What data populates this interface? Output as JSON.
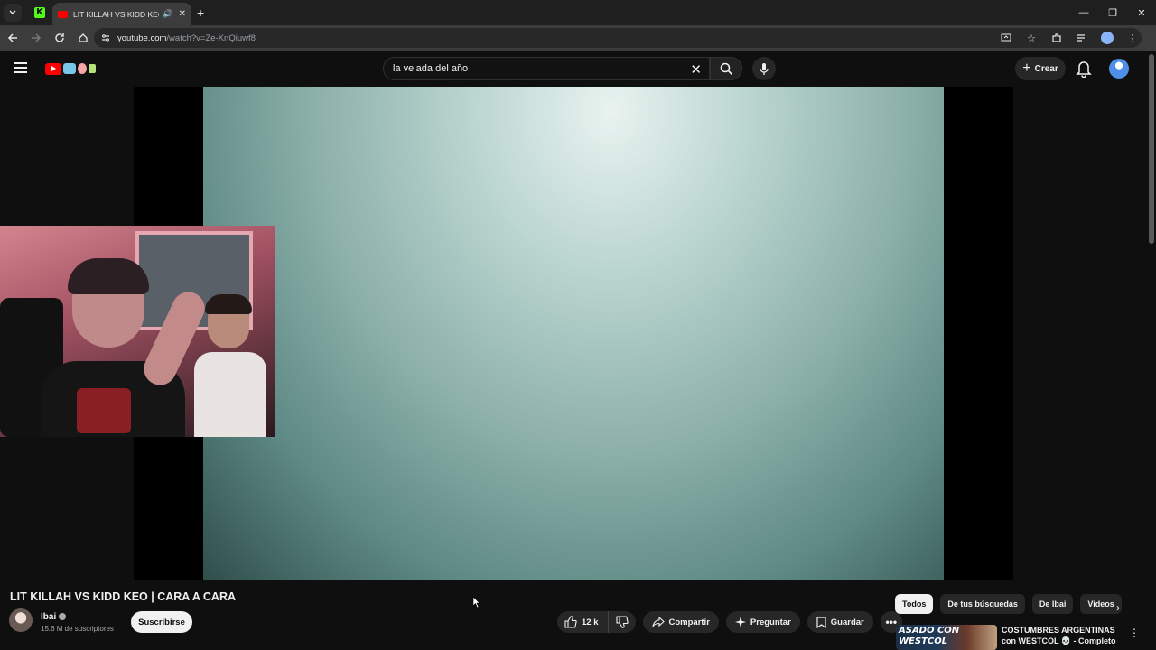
{
  "browser": {
    "active_tab_title": "LIT KILLAH VS KIDD KEO | C",
    "url_host": "youtube.com",
    "url_path": "/watch?v=Ze-KnQiuwf8",
    "new_tab": "+",
    "window_controls": [
      "—",
      "❐",
      "✕"
    ]
  },
  "header": {
    "search_value": "la velada del año",
    "create_label": "Crear"
  },
  "video": {
    "title": "LIT KILLAH VS KIDD KEO | CARA A CARA",
    "channel": "Ibai",
    "subscribers": "15.6 M de suscriptores",
    "subscribe_label": "Suscribirse",
    "likes": "12 k",
    "share_label": "Compartir",
    "ask_label": "Preguntar",
    "save_label": "Guardar"
  },
  "chips": [
    "Todos",
    "De tus búsquedas",
    "De Ibai",
    "Videos"
  ],
  "recommendation": {
    "thumb_text_1": "ASADO CON",
    "thumb_text_2": "WESTCOL",
    "title_line1": "COSTUMBRES ARGENTINAS",
    "title_line2": "con WESTCOL 💀 - Completo"
  },
  "colors": {
    "yt_red": "#ff0000",
    "kick_green": "#53fc18",
    "bg": "#0f0f0f"
  }
}
